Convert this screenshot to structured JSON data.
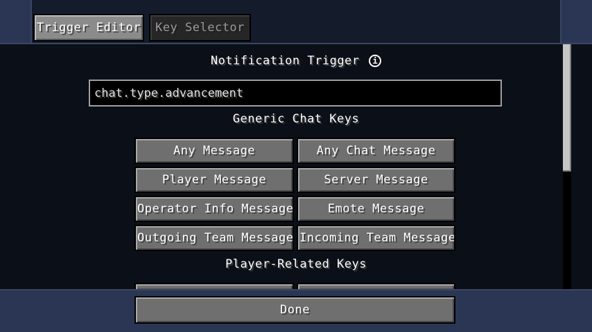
{
  "tabs": [
    {
      "label": "Trigger Editor",
      "active": true
    },
    {
      "label": "Key Selector",
      "active": false
    }
  ],
  "section_title": "Notification Trigger",
  "info_icon_glyph": "i",
  "trigger_field": {
    "value": "chat.type.advancement"
  },
  "generic_heading": "Generic Chat Keys",
  "generic_keys": [
    "Any Message",
    "Any Chat Message",
    "Player Message",
    "Server Message",
    "Operator Info Message",
    "Emote Message",
    "Outgoing Team Message",
    "Incoming Team Message"
  ],
  "player_heading": "Player-Related Keys",
  "done_label": "Done",
  "colors": {
    "background": "#1f2a40",
    "button": "#6f6f6f",
    "text": "#ffffff"
  }
}
